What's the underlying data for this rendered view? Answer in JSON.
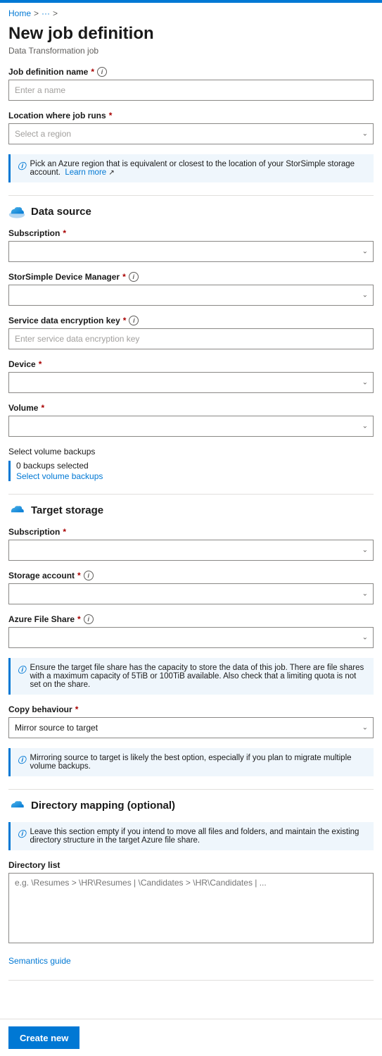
{
  "topbar": {
    "color": "#0078d4"
  },
  "breadcrumb": {
    "home": "Home",
    "separator1": ">",
    "middle": "···",
    "separator2": ">"
  },
  "header": {
    "title": "New job definition",
    "subtitle": "Data Transformation job"
  },
  "form": {
    "job_definition_name": {
      "label": "Job definition name",
      "required": "*",
      "placeholder": "Enter a name"
    },
    "location": {
      "label": "Location where job runs",
      "required": "*",
      "placeholder": "Select a region"
    },
    "location_info": "Pick an Azure region that is equivalent or closest to the location of your StorSimple storage account.",
    "location_learn_more": "Learn more",
    "data_source": {
      "section_title": "Data source",
      "subscription": {
        "label": "Subscription",
        "required": "*"
      },
      "storsimple_device_manager": {
        "label": "StorSimple Device Manager",
        "required": "*"
      },
      "service_data_encryption_key": {
        "label": "Service data encryption key",
        "required": "*",
        "placeholder": "Enter service data encryption key"
      },
      "device": {
        "label": "Device",
        "required": "*"
      },
      "volume": {
        "label": "Volume",
        "required": "*"
      },
      "volume_backups": {
        "label": "Select volume backups",
        "count": "0 backups selected",
        "link": "Select volume backups"
      }
    },
    "target_storage": {
      "section_title": "Target storage",
      "subscription": {
        "label": "Subscription",
        "required": "*"
      },
      "storage_account": {
        "label": "Storage account",
        "required": "*"
      },
      "azure_file_share": {
        "label": "Azure File Share",
        "required": "*"
      },
      "file_share_info": "Ensure the target file share has the capacity to store the data of this job. There are file shares with a maximum capacity of 5TiB or 100TiB available. Also check that a limiting quota is not set on the share.",
      "copy_behaviour": {
        "label": "Copy behaviour",
        "required": "*",
        "value": "Mirror source to target"
      },
      "copy_behaviour_info": "Mirroring source to target is likely the best option, especially if you plan to migrate multiple volume backups."
    },
    "directory_mapping": {
      "section_title": "Directory mapping (optional)",
      "info": "Leave this section empty if you intend to move all files and folders, and maintain the existing directory structure in the target Azure file share.",
      "directory_list_label": "Directory list",
      "directory_list_placeholder": "e.g. \\Resumes > \\HR\\Resumes | \\Candidates > \\HR\\Candidates | ...",
      "semantics_guide": "Semantics guide"
    }
  },
  "footer": {
    "create_button": "Create new"
  }
}
